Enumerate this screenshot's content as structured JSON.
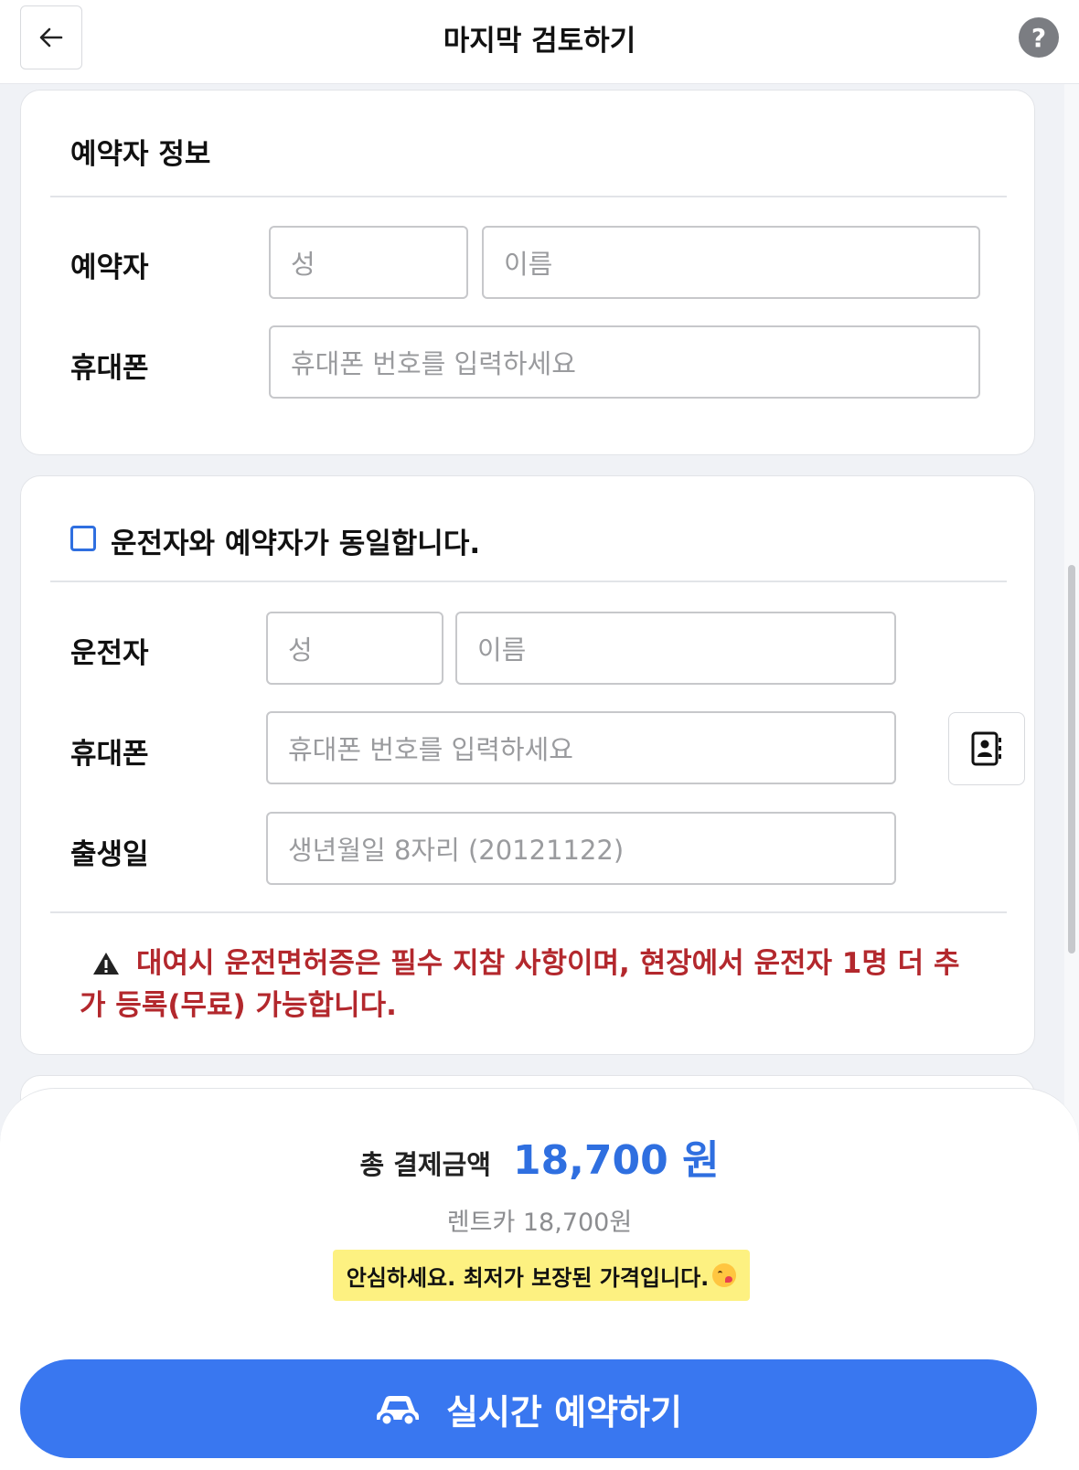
{
  "header": {
    "title": "마지막 검토하기",
    "help_label": "?"
  },
  "booker": {
    "section_title": "예약자 정보",
    "name_label": "예약자",
    "last_name_placeholder": "성",
    "first_name_placeholder": "이름",
    "phone_label": "휴대폰",
    "phone_placeholder": "휴대폰 번호를 입력하세요"
  },
  "driver": {
    "same_as_booker_label": "운전자와 예약자가 동일합니다.",
    "name_label": "운전자",
    "last_name_placeholder": "성",
    "first_name_placeholder": "이름",
    "phone_label": "휴대폰",
    "phone_placeholder": "휴대폰 번호를 입력하세요",
    "birth_label": "출생일",
    "birth_placeholder": "생년월일 8자리 (20121122)",
    "notice": "대여시 운전면허증은 필수 지참 사항이며, 현장에서 운전자 1명 더 추가 등록(무료) 가능합니다."
  },
  "payment": {
    "total_label": "총 결제금액",
    "total_amount": "18,700 원",
    "breakdown": "렌트카 18,700원",
    "promo": "안심하세요. 최저가 보장된 가격입니다."
  },
  "cta": {
    "reserve_label": "실시간 예약하기"
  },
  "icons": {
    "back": "arrow-left-icon",
    "help": "question-icon",
    "contacts": "contact-book-icon",
    "warning": "warning-triangle-icon",
    "car": "car-icon"
  },
  "colors": {
    "accent": "#3977f0",
    "warning_text": "#b3282d",
    "promo_bg": "#fdf181"
  }
}
